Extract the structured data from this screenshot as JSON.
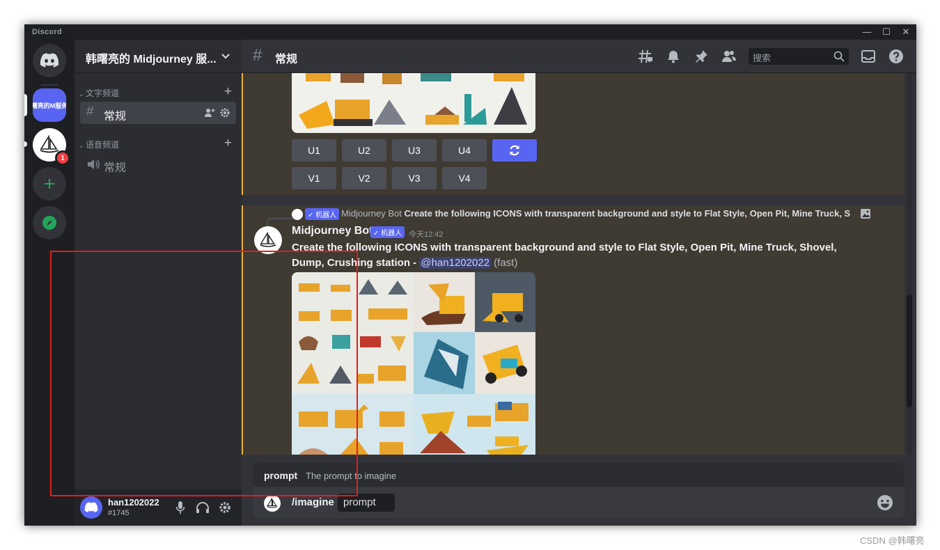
{
  "app": {
    "title": "Discord"
  },
  "window_controls": [
    "—",
    "☐",
    "✕"
  ],
  "servers": [
    {
      "label": "韩曙亮的M服务器",
      "active": true
    },
    {
      "label": "Midjourney",
      "badge": "1"
    }
  ],
  "guild": {
    "name": "韩曙亮的 Midjourney 服..."
  },
  "categories": {
    "text": "文字频道",
    "voice": "语音频道"
  },
  "channels": {
    "text_active": "常规",
    "voice": "常规"
  },
  "user": {
    "name": "han1202022",
    "tag": "#1745"
  },
  "header": {
    "channel": "常规",
    "search_placeholder": "搜索"
  },
  "buttons": {
    "upscale": [
      "U1",
      "U2",
      "U3",
      "U4"
    ],
    "variation": [
      "V1",
      "V2",
      "V3",
      "V4"
    ]
  },
  "message": {
    "reply_author": "Midjourney Bot",
    "reply_text": "Create the following ICONS with transparent background and style to Flat Style, Open Pit, Mine Truck, S",
    "author": "Midjourney Bot",
    "app_tag": "✓ 机器人",
    "timestamp": "今天12:42",
    "content": "Create the following ICONS with transparent background and style to Flat Style, Open Pit, Mine Truck, Shovel, Dump, Crushing station",
    "separator": " - ",
    "mention": "@han1202022",
    "speed": " (fast)"
  },
  "autocomplete": {
    "name": "prompt",
    "desc": "The prompt to imagine"
  },
  "composer": {
    "command": "/imagine",
    "option": "prompt"
  },
  "watermark": "CSDN @韩曙亮",
  "colors": {
    "blurple": "#5865f2",
    "highlight": "#e01e1e",
    "mention_bg": "#3c4270",
    "bot_row": "#3f3a32",
    "accent_border": "#f0b232"
  }
}
